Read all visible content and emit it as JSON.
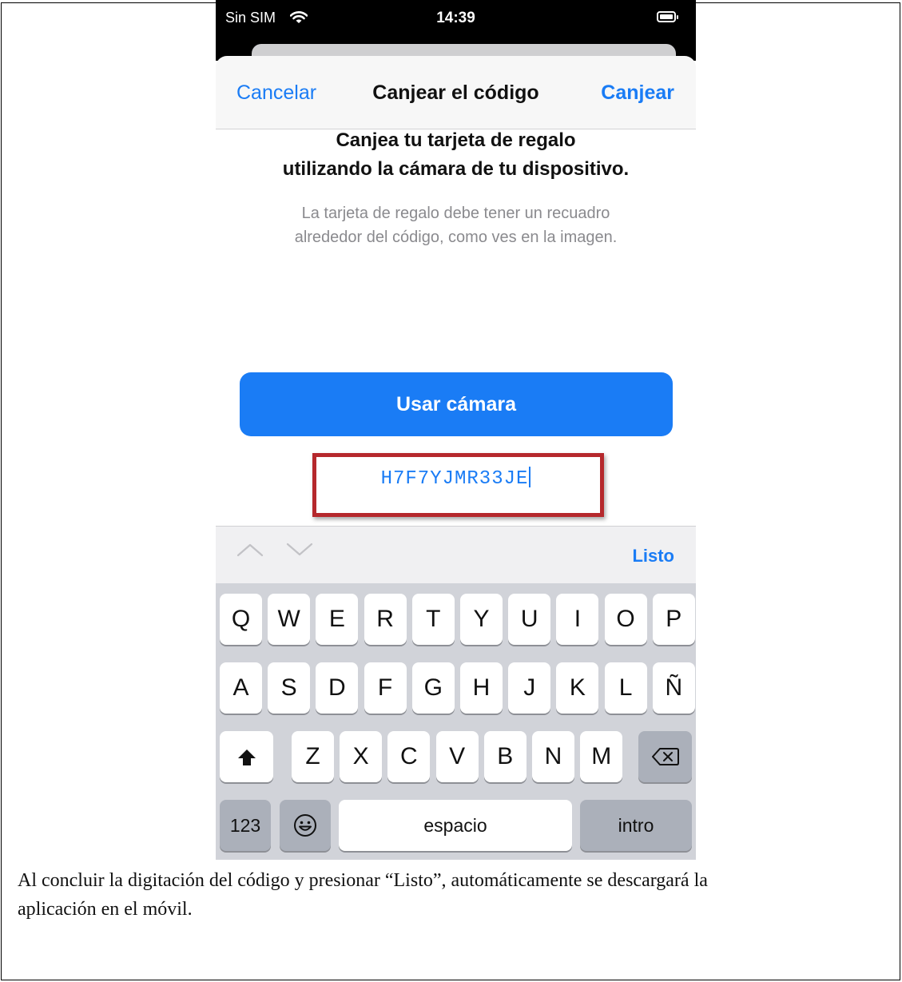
{
  "status_bar": {
    "carrier": "Sin SIM",
    "time": "14:39"
  },
  "nav": {
    "cancel": "Cancelar",
    "title": "Canjear el código",
    "redeem": "Canjear"
  },
  "heading": {
    "line1": "Canjea tu tarjeta de regalo",
    "line2": "utilizando la cámara de tu dispositivo."
  },
  "subtext": {
    "line1": "La tarjeta de regalo debe tener un recuadro",
    "line2": "alrededor del código, como ves en la imagen."
  },
  "camera_button": "Usar cámara",
  "code_field": {
    "value": "H7F7YJMR33JE"
  },
  "keyboard_toolbar": {
    "done": "Listo"
  },
  "keyboard": {
    "row1": [
      "Q",
      "W",
      "E",
      "R",
      "T",
      "Y",
      "U",
      "I",
      "O",
      "P"
    ],
    "row2": [
      "A",
      "S",
      "D",
      "F",
      "G",
      "H",
      "J",
      "K",
      "L",
      "Ñ"
    ],
    "row3": [
      "Z",
      "X",
      "C",
      "V",
      "B",
      "N",
      "M"
    ],
    "numbers": "123",
    "space": "espacio",
    "return": "intro"
  },
  "icons": {
    "wifi": "wifi-icon",
    "battery": "battery-icon",
    "shift": "shift-icon",
    "delete": "delete-icon",
    "emoji": "emoji-icon",
    "prev": "chevron-up-icon",
    "next": "chevron-down-icon"
  },
  "colors": {
    "accent": "#1a7cf5",
    "highlight": "#b5282c",
    "keyboard_bg": "#d1d3d9"
  },
  "caption": {
    "line1": "Al concluir la digitación del código y presionar “Listo”, automáticamente se descargará la",
    "line2": "aplicación en el móvil."
  }
}
